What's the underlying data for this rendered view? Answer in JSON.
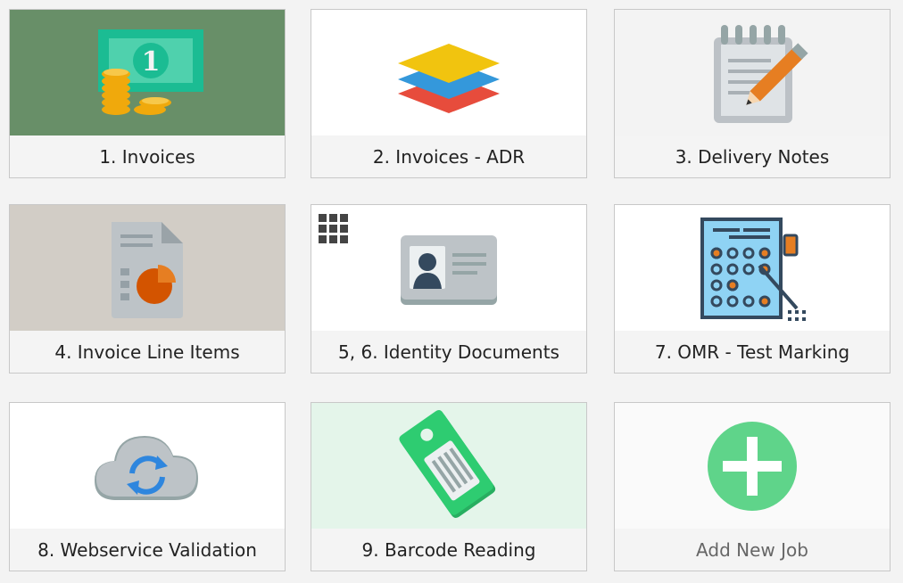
{
  "jobs": [
    {
      "label": "1. Invoices",
      "icon": "cash-coins-icon",
      "bg": "#688f68"
    },
    {
      "label": "2. Invoices - ADR",
      "icon": "layers-icon",
      "bg": "#ffffff"
    },
    {
      "label": "3. Delivery Notes",
      "icon": "notepad-pencil-icon",
      "bg": "#f3f3f3"
    },
    {
      "label": "4. Invoice Line Items",
      "icon": "document-chart-icon",
      "bg": "#d2cdc6"
    },
    {
      "label": "5, 6. Identity Documents",
      "icon": "id-card-icon",
      "bg": "#ffffff"
    },
    {
      "label": "7. OMR - Test Marking",
      "icon": "omr-sheet-icon",
      "bg": "#ffffff"
    },
    {
      "label": "8. Webservice Validation",
      "icon": "cloud-sync-icon",
      "bg": "#ffffff"
    },
    {
      "label": "9. Barcode Reading",
      "icon": "price-tag-icon",
      "bg": "#e4f5ea"
    },
    {
      "label": "Add New Job",
      "icon": "plus-circle-icon",
      "bg": "#fafafa"
    }
  ]
}
